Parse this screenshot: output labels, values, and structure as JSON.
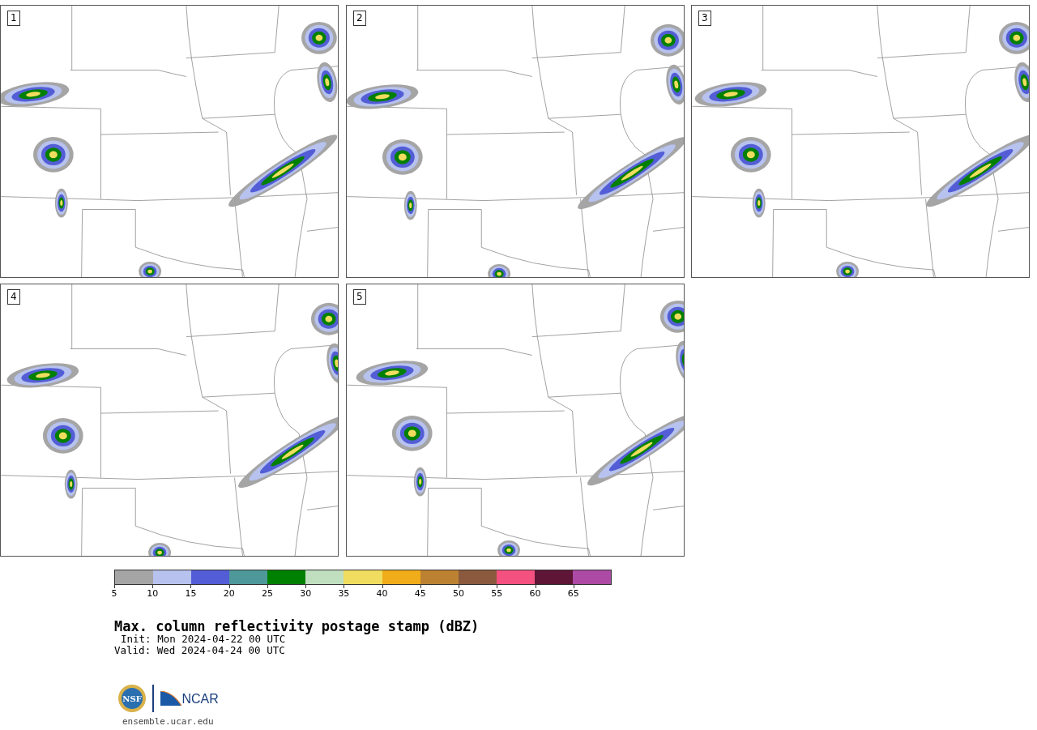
{
  "panels": [
    {
      "label": "1"
    },
    {
      "label": "2"
    },
    {
      "label": "3"
    },
    {
      "label": "4"
    },
    {
      "label": "5"
    }
  ],
  "colorbar": {
    "bins": [
      {
        "color": "#a5a5a5"
      },
      {
        "color": "#b7c2ee"
      },
      {
        "color": "#535ed6"
      },
      {
        "color": "#4e9899"
      },
      {
        "color": "#008000"
      },
      {
        "color": "#bfdfbf"
      },
      {
        "color": "#f0dc5e"
      },
      {
        "color": "#f0ac19"
      },
      {
        "color": "#bc8232"
      },
      {
        "color": "#8b5a3e"
      },
      {
        "color": "#f45080"
      },
      {
        "color": "#5f1535"
      },
      {
        "color": "#ac4aa5"
      }
    ],
    "ticks": [
      "5",
      "10",
      "15",
      "20",
      "25",
      "30",
      "35",
      "40",
      "45",
      "50",
      "55",
      "60",
      "65"
    ]
  },
  "title": "Max. column reflectivity postage stamp (dBZ)",
  "init": "Init: Mon 2024-04-22 00 UTC",
  "valid": "Valid: Wed 2024-04-24 00 UTC",
  "logo": {
    "seal_text": "NSF",
    "wordmark": "NCAR"
  },
  "footer_url": "ensemble.ucar.edu"
}
